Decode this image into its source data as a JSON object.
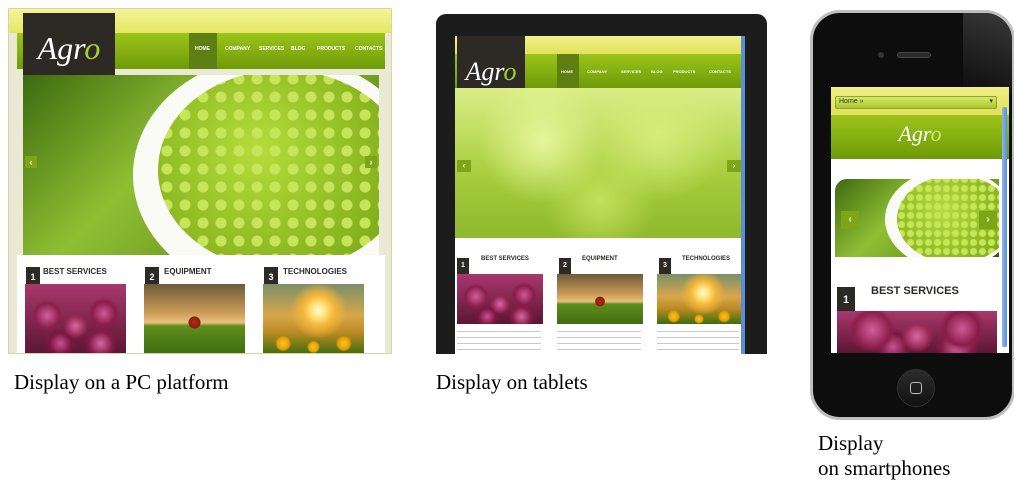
{
  "captions": {
    "pc": "Display on a PC platform",
    "tablet": "Display on tablets",
    "phone_line1": "Display",
    "phone_line2": "on smartphones"
  },
  "site": {
    "logo_main": "Agr",
    "logo_accent": "o",
    "nav": [
      "HOME",
      "COMPANY",
      "SERVICES",
      "BLOG",
      "PRODUCTS",
      "CONTACTS"
    ],
    "slider_prev": "‹",
    "slider_next": "›",
    "sections": [
      {
        "num": "1",
        "title": "BEST SERVICES"
      },
      {
        "num": "2",
        "title": "EQUIPMENT"
      },
      {
        "num": "3",
        "title": "TECHNOLOGIES"
      }
    ],
    "phone_menu": "Home »"
  },
  "colors": {
    "accent": "#8bb41a",
    "dark": "#2d2a26",
    "device": "#111111"
  },
  "icons": [
    "arrow-left-icon",
    "arrow-right-icon",
    "home-button-icon",
    "dropdown-arrow-icon"
  ]
}
